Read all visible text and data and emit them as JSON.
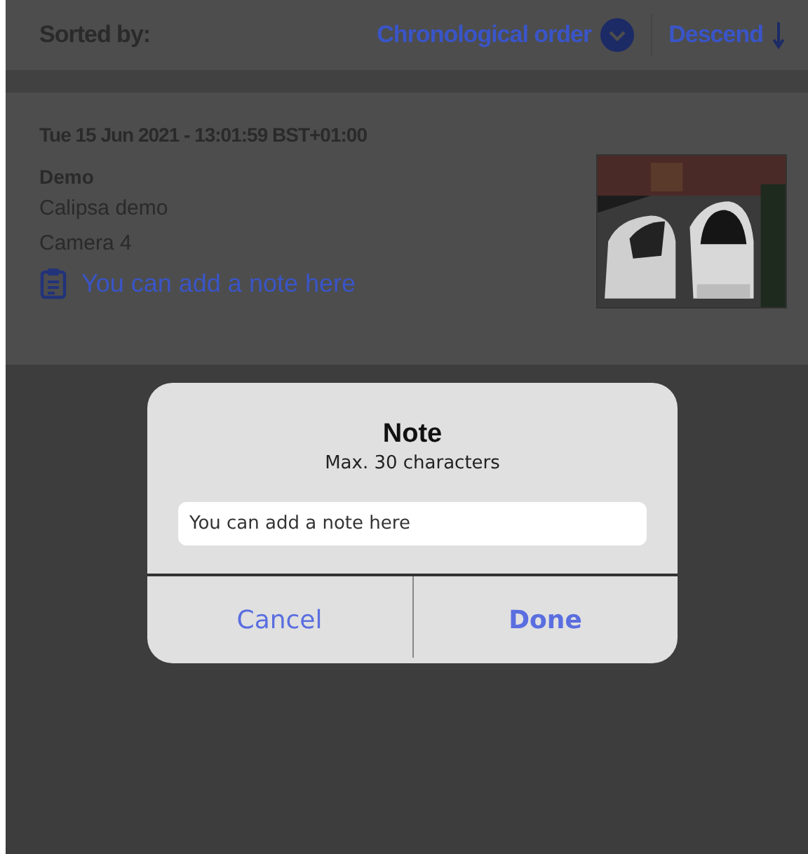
{
  "sort_bar": {
    "label": "Sorted by:",
    "order": "Chronological order",
    "direction": "Descend"
  },
  "event": {
    "timestamp": "Tue 15 Jun 2021 - 13:01:59 BST+01:00",
    "title": "Demo",
    "site": "Calipsa demo",
    "camera": "Camera 4",
    "note": "You can add a note here"
  },
  "dialog": {
    "title": "Note",
    "subtitle": "Max. 30 characters",
    "field": {
      "placeholder": "You can add a note here"
    },
    "buttons": [
      {
        "label": "Cancel",
        "kind": "cancel"
      },
      {
        "label": "Done",
        "kind": "confirm"
      }
    ]
  }
}
